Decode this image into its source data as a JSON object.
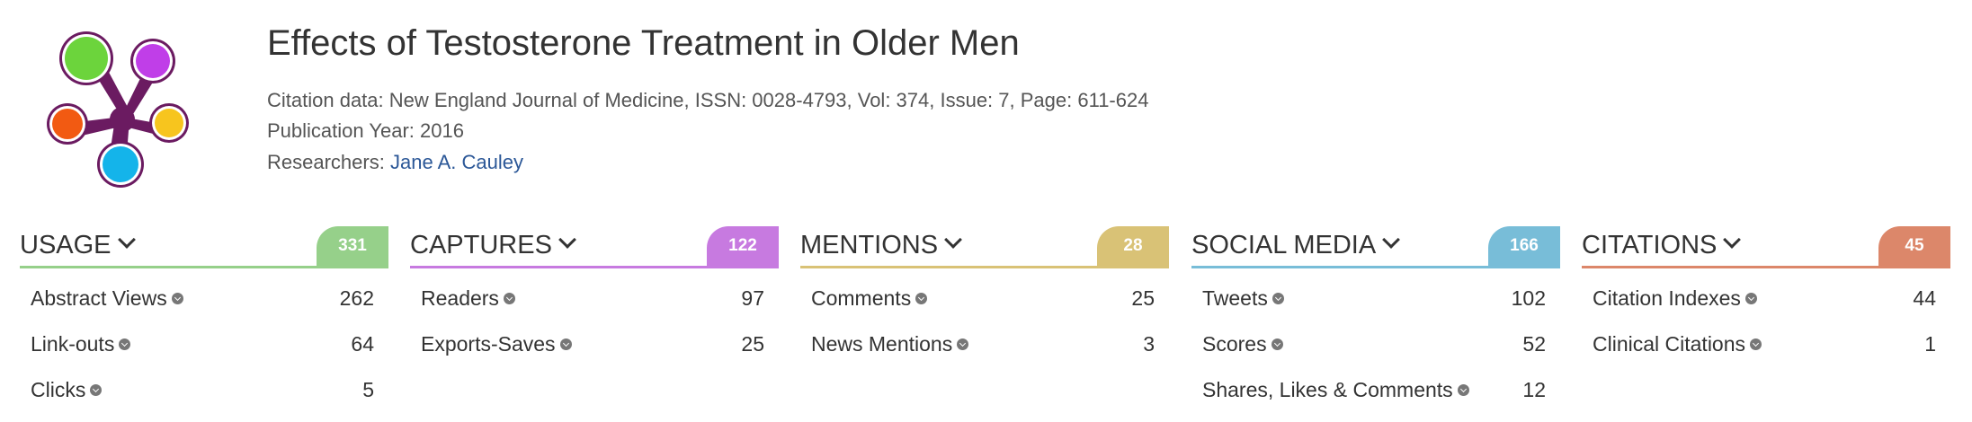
{
  "article": {
    "title": "Effects of Testosterone Treatment in Older Men",
    "citation_label": "Citation data:",
    "citation_value": "New England Journal of Medicine, ISSN: 0028-4793, Vol: 374, Issue: 7, Page: 611-624",
    "year_label": "Publication Year:",
    "year_value": "2016",
    "researchers_label": "Researchers:",
    "researcher": "Jane A. Cauley"
  },
  "logo": {
    "petal_colors": [
      "#6cd43c",
      "#c03ee8",
      "#f7c51e",
      "#14b4ea",
      "#f25a12"
    ],
    "hub_color": "#6b1b61"
  },
  "columns": [
    {
      "title": "USAGE",
      "count": "331",
      "color": "#96d08a",
      "rows": [
        {
          "label": "Abstract Views",
          "value": "262"
        },
        {
          "label": "Link-outs",
          "value": "64"
        },
        {
          "label": "Clicks",
          "value": "5"
        }
      ]
    },
    {
      "title": "CAPTURES",
      "count": "122",
      "color": "#c77ae0",
      "rows": [
        {
          "label": "Readers",
          "value": "97"
        },
        {
          "label": "Exports-Saves",
          "value": "25"
        }
      ]
    },
    {
      "title": "MENTIONS",
      "count": "28",
      "color": "#d9c276",
      "rows": [
        {
          "label": "Comments",
          "value": "25"
        },
        {
          "label": "News Mentions",
          "value": "3"
        }
      ]
    },
    {
      "title": "SOCIAL MEDIA",
      "count": "166",
      "color": "#78bdd8",
      "rows": [
        {
          "label": "Tweets",
          "value": "102"
        },
        {
          "label": "Scores",
          "value": "52"
        },
        {
          "label": "Shares, Likes & Comments",
          "value": "12"
        }
      ]
    },
    {
      "title": "CITATIONS",
      "count": "45",
      "color": "#dc876a",
      "rows": [
        {
          "label": "Citation Indexes",
          "value": "44"
        },
        {
          "label": "Clinical Citations",
          "value": "1"
        }
      ]
    }
  ]
}
